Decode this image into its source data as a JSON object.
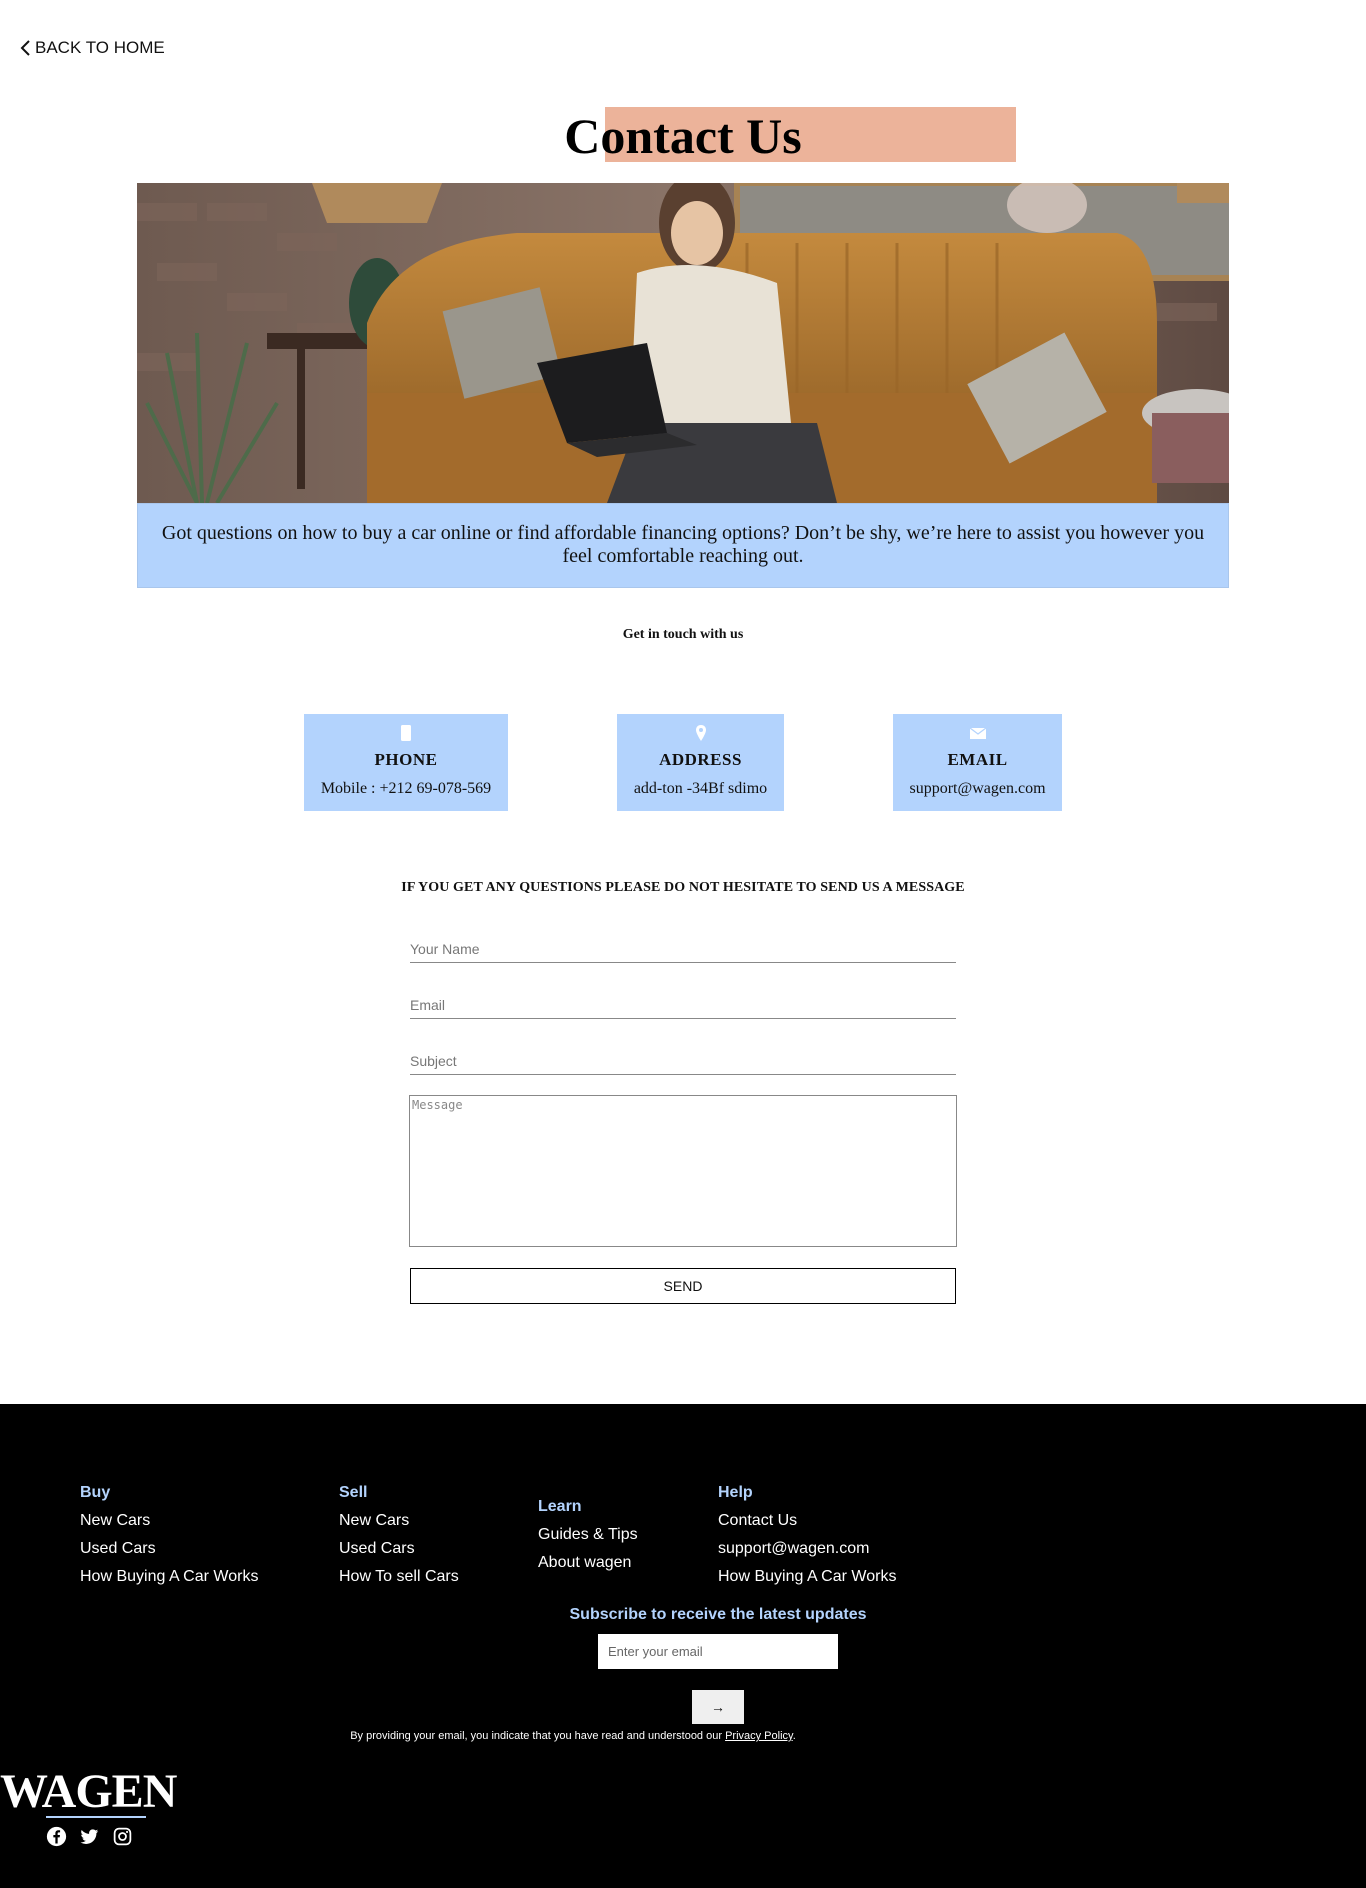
{
  "nav": {
    "back_label": "BACK TO HOME"
  },
  "header": {
    "title": "Contact Us"
  },
  "intro": {
    "text": "Got questions on how to buy a car online or find affordable financing options? Don’t be shy, we’re here to assist you however you feel comfortable reaching out."
  },
  "touch": {
    "heading": "Get in touch with us"
  },
  "cards": {
    "phone": {
      "icon": "phone-icon",
      "title": "PHONE",
      "value": "Mobile : +212 69-078-569"
    },
    "address": {
      "icon": "map-pin-icon",
      "title": "ADDRESS",
      "value": "add-ton -34Bf sdimo"
    },
    "email": {
      "icon": "envelope-icon",
      "title": "EMAIL",
      "value": "support@wagen.com"
    }
  },
  "form": {
    "heading": "IF YOU GET ANY QUESTIONS PLEASE DO NOT HESITATE TO SEND US A MESSAGE",
    "name_placeholder": "Your Name",
    "email_placeholder": "Email",
    "subject_placeholder": "Subject",
    "message_placeholder": "Message",
    "send_label": "SEND"
  },
  "footer": {
    "buy": {
      "heading": "Buy",
      "links": [
        "New Cars",
        "Used Cars",
        "How Buying A Car Works"
      ]
    },
    "sell": {
      "heading": "Sell",
      "links": [
        "New Cars",
        "Used Cars",
        "How To sell Cars"
      ]
    },
    "learn": {
      "heading": "Learn",
      "links": [
        "Guides & Tips",
        "About wagen"
      ]
    },
    "help": {
      "heading": "Help",
      "links": [
        "Contact Us",
        "support@wagen.com",
        "How Buying A Car Works"
      ]
    },
    "subscribe": {
      "title": "Subscribe to receive the latest updates",
      "placeholder": "Enter your email",
      "button": "→",
      "disclaimer": "By providing your email, you indicate that you have read and understood our ",
      "policy_link": "Privacy Policy",
      "period": "."
    },
    "logo": "WAGEN",
    "socials": [
      "facebook-icon",
      "twitter-icon",
      "instagram-icon"
    ]
  },
  "colors": {
    "accent_blue": "#b3d3fd",
    "title_highlight": "#ecb39a",
    "footer_bg": "#000000"
  }
}
